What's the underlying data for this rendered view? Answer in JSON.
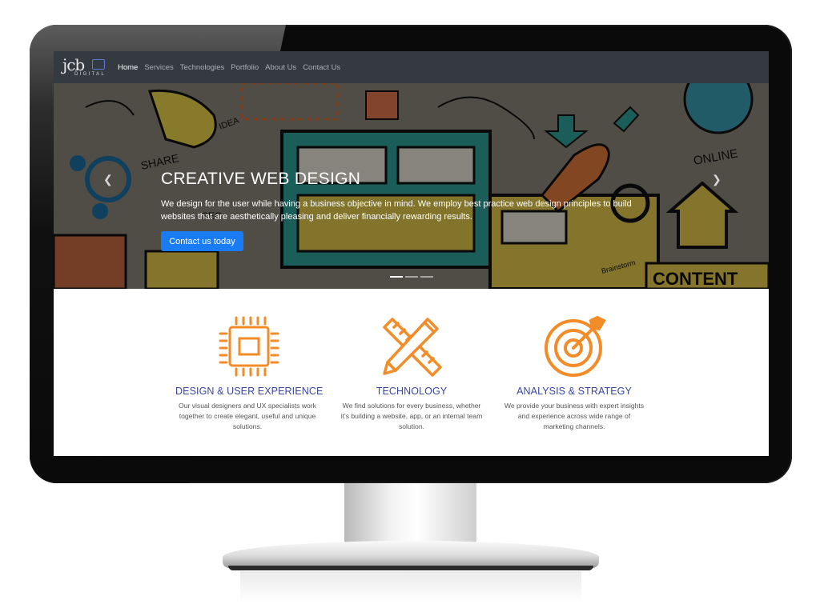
{
  "nav": {
    "logo_main": "jcb",
    "logo_sub": "DIGITAL",
    "links": [
      "Home",
      "Services",
      "Technologies",
      "Portfolio",
      "About Us",
      "Contact Us"
    ],
    "active": "Home"
  },
  "hero": {
    "title": "CREATIVE WEB DESIGN",
    "text": "We design for the user while having a business objective in mind. We employ best practice web design principles to build websites that are aesthetically pleasing and deliver financially rewarding results.",
    "button": "Contact us today",
    "prev_icon": "chevron-left-icon",
    "next_icon": "chevron-right-icon",
    "art_labels": [
      "SHARE",
      "IDEA",
      "ONLINE",
      "CONTENT",
      "Brainstorm",
      "SEO"
    ]
  },
  "features": [
    {
      "icon": "processor-chip-icon",
      "title": "DESIGN & USER EXPERIENCE",
      "desc": "Our visual designers and UX specialists work together to create elegant, useful and unique solutions."
    },
    {
      "icon": "pencil-ruler-icon",
      "title": "TECHNOLOGY",
      "desc": "We find solutions for every business, whether it's building a website, app, or an internal team solution."
    },
    {
      "icon": "target-arrow-icon",
      "title": "ANALYSIS & STRATEGY",
      "desc": "We provide your business with expert insights and experience across wide range of marketing channels."
    }
  ],
  "colors": {
    "accent": "#f28c28",
    "title_blue": "#3a45a0",
    "button_blue": "#1a7cf5",
    "navbar": "#343a40"
  }
}
